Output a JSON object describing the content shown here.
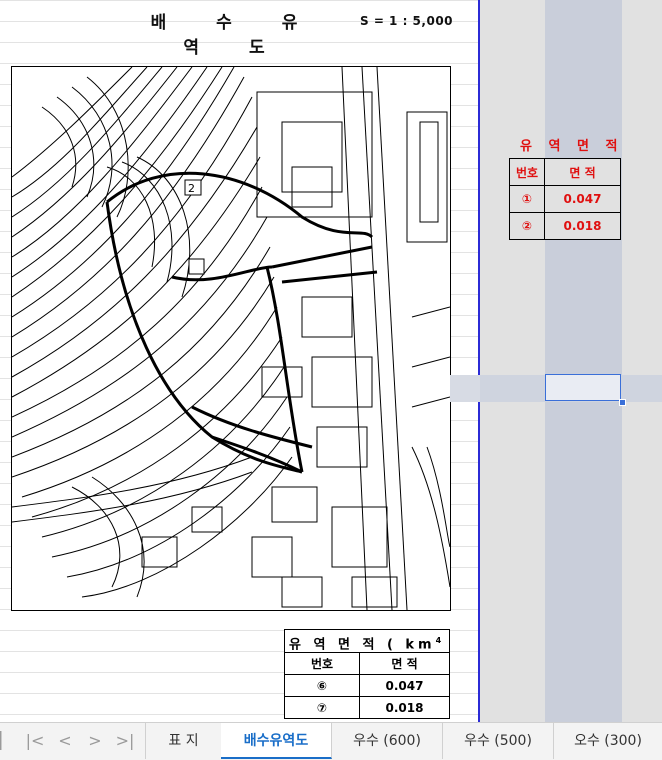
{
  "sheet": {
    "title": "배 수 유 역 도",
    "scale": "S = 1 : 5,000",
    "map": {
      "basin_label": "2"
    }
  },
  "side_table": {
    "title": "유 역 면 적",
    "headers": [
      "번호",
      "면 적"
    ],
    "rows": [
      {
        "no": "①",
        "area": "0.047"
      },
      {
        "no": "②",
        "area": "0.018"
      }
    ],
    "color": "#e01010"
  },
  "bottom_table": {
    "title": "유 역 면 적 ( km",
    "title_sup": "4",
    "title_close": ")",
    "headers": [
      "번호",
      "면 적"
    ],
    "rows": [
      {
        "no": "⑥",
        "area": "0.047"
      },
      {
        "no": "⑦",
        "area": "0.018"
      }
    ]
  },
  "tabs": {
    "nav": [
      "|<",
      "<",
      ">",
      ">|"
    ],
    "items": [
      "표 지",
      "배수유역도",
      "우수 (600)",
      "우수 (500)",
      "오수 (300)"
    ],
    "active": "배수유역도",
    "active_color": "#1a6ec8"
  }
}
